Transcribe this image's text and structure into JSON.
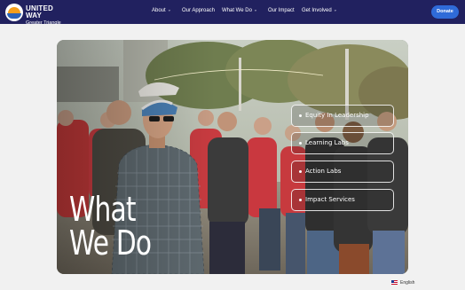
{
  "brand": {
    "name_line1": "UNITED WAY",
    "name_line2": "Greater Triangle"
  },
  "nav": {
    "items": [
      {
        "label": "About",
        "has_dropdown": true
      },
      {
        "label": "Our Approach",
        "has_dropdown": false
      },
      {
        "label": "What We Do",
        "has_dropdown": true
      },
      {
        "label": "Our Impact",
        "has_dropdown": false
      },
      {
        "label": "Get Involved",
        "has_dropdown": true
      }
    ],
    "chevron_glyph": "⌄",
    "donate_label": "Donate"
  },
  "hero": {
    "title_line1": "What",
    "title_line2": "We Do",
    "menu": [
      {
        "label": "Equity In Leadership"
      },
      {
        "label": "Learning Labs"
      },
      {
        "label": "Action Labs"
      },
      {
        "label": "Impact Services"
      }
    ]
  },
  "footer": {
    "language": "English"
  },
  "colors": {
    "header_bg": "#21215f",
    "donate_bg": "#2f6bd8",
    "page_bg": "#f1f1f1"
  }
}
